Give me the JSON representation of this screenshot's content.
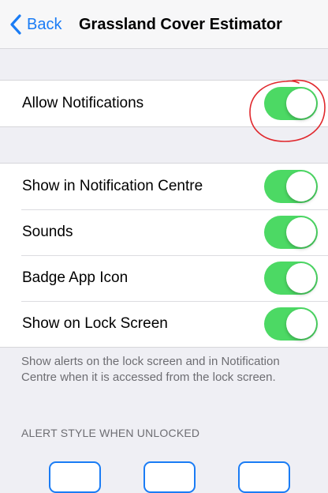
{
  "nav": {
    "back_label": "Back",
    "title": "Grassland Cover Estimator"
  },
  "notifications": {
    "allow": {
      "label": "Allow Notifications",
      "enabled": true
    }
  },
  "settings": {
    "items": [
      {
        "label": "Show in Notification Centre",
        "enabled": true
      },
      {
        "label": "Sounds",
        "enabled": true
      },
      {
        "label": "Badge App Icon",
        "enabled": true
      },
      {
        "label": "Show on Lock Screen",
        "enabled": true
      }
    ]
  },
  "lock_screen_note": "Show alerts on the lock screen and in Notification Centre when it is accessed from the lock screen.",
  "alert_style": {
    "header": "ALERT STYLE WHEN UNLOCKED"
  },
  "colors": {
    "accent": "#1a7cf5",
    "toggle_on": "#4cd964",
    "annotation": "#e0282d"
  }
}
